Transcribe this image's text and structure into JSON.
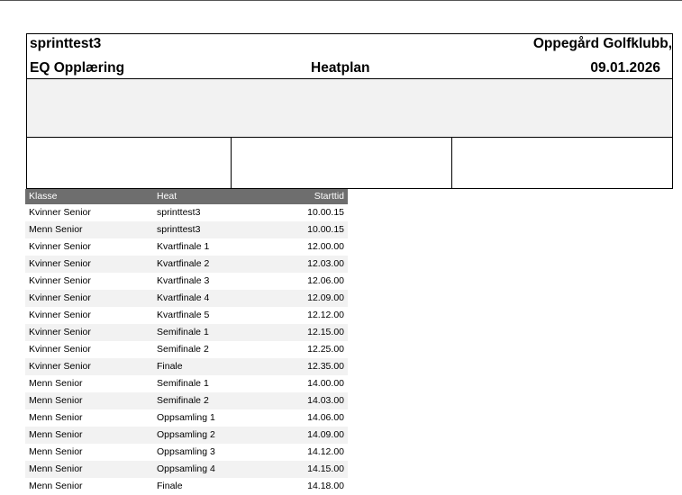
{
  "header": {
    "event": "sprinttest3",
    "club": "Oppegård Golfklubb,",
    "subtitle": "EQ Opplæring",
    "doc_title": "Heatplan",
    "date": "09.01.2026"
  },
  "table": {
    "columns": [
      "Klasse",
      "Heat",
      "Starttid"
    ],
    "rows": [
      [
        "Kvinner Senior",
        "sprinttest3",
        "10.00.15"
      ],
      [
        "Menn Senior",
        "sprinttest3",
        "10.00.15"
      ],
      [
        "Kvinner Senior",
        "Kvartfinale 1",
        "12.00.00"
      ],
      [
        "Kvinner Senior",
        "Kvartfinale 2",
        "12.03.00"
      ],
      [
        "Kvinner Senior",
        "Kvartfinale 3",
        "12.06.00"
      ],
      [
        "Kvinner Senior",
        "Kvartfinale 4",
        "12.09.00"
      ],
      [
        "Kvinner Senior",
        "Kvartfinale 5",
        "12.12.00"
      ],
      [
        "Kvinner Senior",
        "Semifinale 1",
        "12.15.00"
      ],
      [
        "Kvinner Senior",
        "Semifinale 2",
        "12.25.00"
      ],
      [
        "Kvinner Senior",
        "Finale",
        "12.35.00"
      ],
      [
        "Menn Senior",
        "Semifinale 1",
        "14.00.00"
      ],
      [
        "Menn Senior",
        "Semifinale 2",
        "14.03.00"
      ],
      [
        "Menn Senior",
        "Oppsamling 1",
        "14.06.00"
      ],
      [
        "Menn Senior",
        "Oppsamling 2",
        "14.09.00"
      ],
      [
        "Menn Senior",
        "Oppsamling 3",
        "14.12.00"
      ],
      [
        "Menn Senior",
        "Oppsamling 4",
        "14.15.00"
      ],
      [
        "Menn Senior",
        "Finale",
        "14.18.00"
      ]
    ]
  }
}
